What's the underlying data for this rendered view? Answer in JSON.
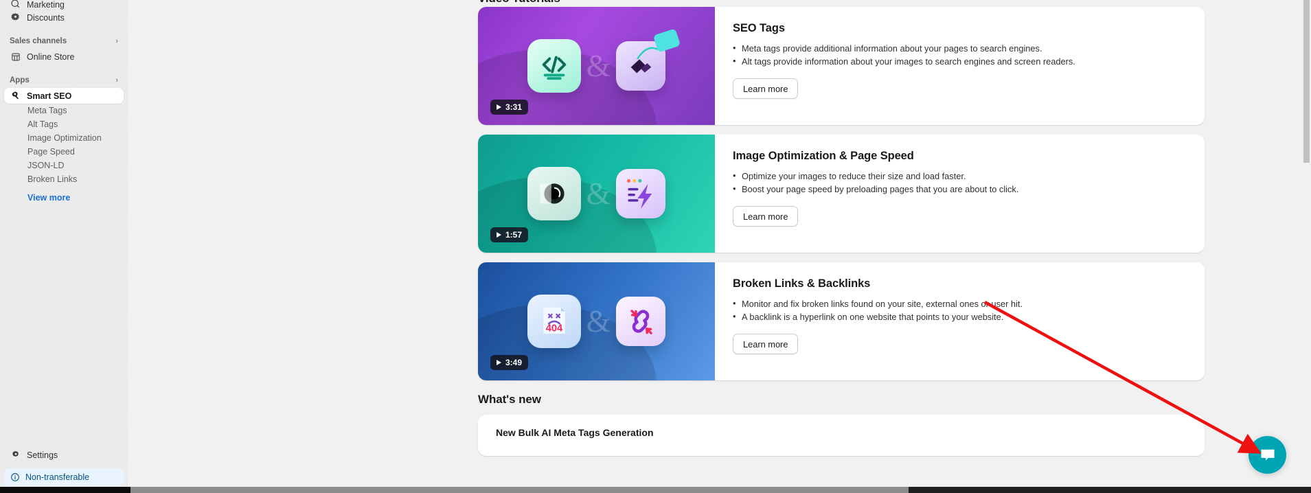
{
  "sidebar": {
    "top_items": [
      {
        "label": "Marketing",
        "icon": "megaphone-icon"
      },
      {
        "label": "Discounts",
        "icon": "discount-tag-icon"
      }
    ],
    "sales_channels": {
      "label": "Sales channels",
      "chevron": "›"
    },
    "online_store": {
      "label": "Online Store",
      "icon": "storefront-icon"
    },
    "apps": {
      "label": "Apps",
      "chevron": "›"
    },
    "active_app": {
      "label": "Smart SEO",
      "icon": "seo-search-icon"
    },
    "app_subitems": [
      {
        "label": "Meta Tags"
      },
      {
        "label": "Alt Tags"
      },
      {
        "label": "Image Optimization"
      },
      {
        "label": "Page Speed"
      },
      {
        "label": "JSON-LD"
      },
      {
        "label": "Broken Links"
      }
    ],
    "view_more": "View more",
    "settings": {
      "label": "Settings",
      "icon": "gear-icon"
    },
    "non_transferable": {
      "label": "Non-transferable",
      "icon": "info-circle-icon"
    }
  },
  "main": {
    "video_tutorials_title": "Video Tutorials",
    "whats_new_title": "What's new",
    "whats_new_item": "New Bulk AI Meta Tags Generation",
    "cards": [
      {
        "title": "SEO Tags",
        "duration": "3:31",
        "bullets": [
          "Meta tags provide additional information about your pages to search engines.",
          "Alt tags provide information about your images to search engines and screen readers."
        ],
        "button": "Learn more",
        "theme": "purple",
        "left_icon": "code-brackets-icon",
        "right_icon": "price-tag-icon"
      },
      {
        "title": "Image Optimization & Page Speed",
        "duration": "1:57",
        "bullets": [
          "Optimize your images to reduce their size and load faster.",
          "Boost your page speed by preloading pages that you are about to click."
        ],
        "button": "Learn more",
        "theme": "teal",
        "left_icon": "camera-lens-icon",
        "right_icon": "lightning-browser-icon"
      },
      {
        "title": "Broken Links & Backlinks",
        "duration": "3:49",
        "bullets": [
          "Monitor and fix broken links found on your site, external ones or user hit.",
          "A backlink is a hyperlink on one website that points to your website."
        ],
        "button": "Learn more",
        "theme": "blue",
        "left_icon": "404-document-icon",
        "right_icon": "chain-link-icon"
      }
    ],
    "ampersand": "&"
  },
  "chat": {
    "icon": "chat-bubble-icon",
    "color": "#00a5b5"
  },
  "annotation": {
    "color": "#ee1111"
  },
  "colors": {
    "accent_link": "#1a6fd4",
    "sidebar_bg": "#ebebeb",
    "page_bg": "#f1f1f1"
  }
}
